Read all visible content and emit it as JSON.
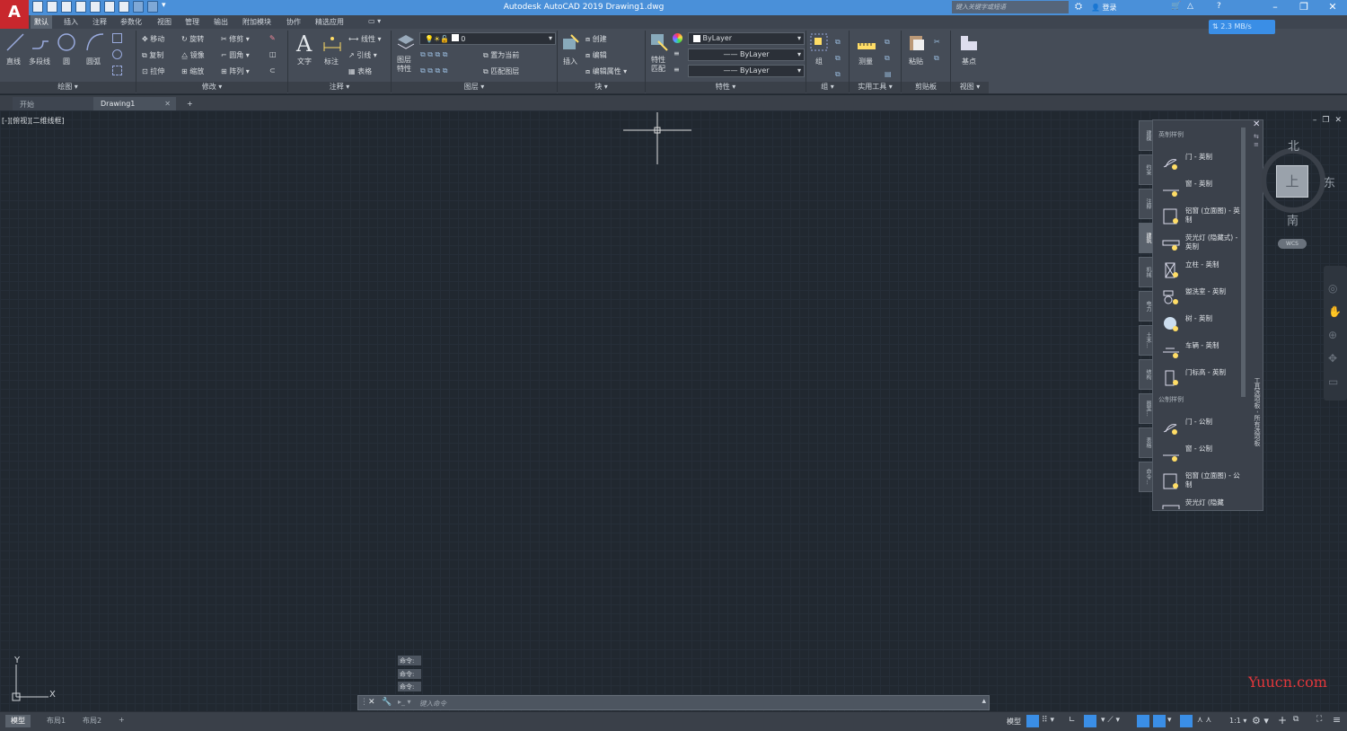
{
  "titlebar": {
    "app_logo": "A",
    "title": "Autodesk AutoCAD 2019    Drawing1.dwg",
    "search_placeholder": "键入关键字或短语",
    "login": "登录",
    "speed": "2.3 MB/s"
  },
  "ribbon_tabs": [
    "默认",
    "插入",
    "注释",
    "参数化",
    "视图",
    "管理",
    "输出",
    "附加模块",
    "协作",
    "精选应用"
  ],
  "ribbon": {
    "draw": {
      "line": "直线",
      "polyline": "多段线",
      "circle": "圆",
      "arc": "圆弧",
      "footer": "绘图"
    },
    "modify": {
      "move": "移动",
      "rotate": "旋转",
      "trim": "修剪",
      "copy": "复制",
      "mirror": "镜像",
      "fillet": "圆角",
      "stretch": "拉伸",
      "scale": "缩放",
      "array": "阵列",
      "footer": "修改"
    },
    "annotation": {
      "text": "文字",
      "dimension": "标注",
      "linear": "线性",
      "leader": "引线",
      "table": "表格",
      "footer": "注释"
    },
    "layers": {
      "layer_props": "图层\n特性",
      "layer_name": "0",
      "make_current": "置为当前",
      "match_layer": "匹配图层",
      "footer": "图层"
    },
    "block": {
      "insert": "插入",
      "create": "创建",
      "edit": "编辑",
      "edit_attr": "编辑属性",
      "footer": "块"
    },
    "properties": {
      "match": "特性\n匹配",
      "color": "ByLayer",
      "linetype": "ByLayer",
      "lineweight": "ByLayer",
      "footer": "特性"
    },
    "groups": {
      "group": "组",
      "footer": "组"
    },
    "utilities": {
      "measure": "测量",
      "footer": "实用工具"
    },
    "clipboard": {
      "paste": "粘贴",
      "footer": "剪贴板"
    },
    "view": {
      "base": "基点",
      "footer": "视图"
    }
  },
  "doc_tabs": {
    "start": "开始",
    "drawing": "Drawing1"
  },
  "viewport_label": "[-][俯视][二维线框]",
  "palette": {
    "imperial_header": "英制样例",
    "imperial_items": [
      "门 - 英制",
      "窗 - 英制",
      "铝窗 (立面图) - 英制",
      "荧光灯 (隐藏式) - 英制",
      "立柱 - 英制",
      "盥洗室 - 英制",
      "树 - 英制",
      "车辆 - 英制",
      "门标高 - 英制"
    ],
    "metric_header": "公制样例",
    "metric_items": [
      "门 - 公制",
      "窗 - 公制",
      "铝窗 (立面图) - 公制",
      "荧光灯 (隐藏"
    ],
    "title": "工具选项板 - 所有选项板",
    "side_tabs": [
      "建模",
      "约束",
      "注释",
      "建筑",
      "机械",
      "电力",
      "土木...",
      "结构",
      "图案...",
      "表格",
      "命令..."
    ]
  },
  "viewcube": {
    "north": "北",
    "east": "东",
    "south": "南",
    "top": "上",
    "wcs": "WCS"
  },
  "command": {
    "history": [
      "命令:",
      "命令:",
      "命令:"
    ],
    "placeholder": "键入命令"
  },
  "ucs": {
    "x": "X",
    "y": "Y"
  },
  "statusbar": {
    "model": "模型",
    "layout1": "布局1",
    "layout2": "布局2",
    "scale": "1:1"
  },
  "watermark": "Yuucn.com"
}
